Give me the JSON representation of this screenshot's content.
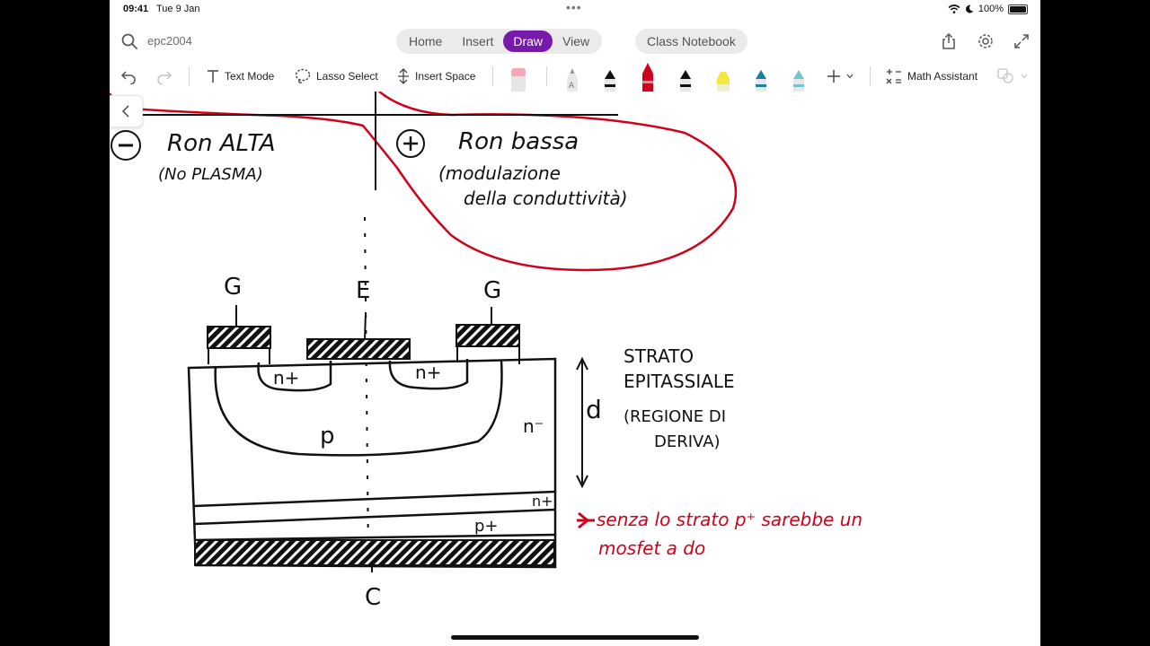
{
  "status_bar": {
    "time": "09:41",
    "date": "Tue 9 Jan",
    "battery": "100%",
    "battery_level": 1.0
  },
  "header": {
    "notebook_name": "epc2004",
    "tabs": [
      {
        "label": "Home",
        "active": false
      },
      {
        "label": "Insert",
        "active": false
      },
      {
        "label": "Draw",
        "active": true
      },
      {
        "label": "View",
        "active": false
      }
    ],
    "class_notebook_label": "Class Notebook",
    "accent_color": "#7719aa"
  },
  "toolbar": {
    "text_mode_label": "Text Mode",
    "lasso_select_label": "Lasso Select",
    "insert_space_label": "Insert Space",
    "math_assistant_label": "Math Assistant",
    "pens": [
      {
        "name": "eraser",
        "color": "#f2a9b8"
      },
      {
        "name": "pencil",
        "color": "#9a9a9a"
      },
      {
        "name": "black-pen",
        "color": "#111111"
      },
      {
        "name": "red-pen",
        "color": "#d0021b"
      },
      {
        "name": "black-pen-2",
        "color": "#111111"
      },
      {
        "name": "highlighter",
        "color": "#f5e642"
      },
      {
        "name": "teal-pen",
        "color": "#1d7fa0"
      },
      {
        "name": "light-teal-pen",
        "color": "#74c3d2"
      }
    ]
  },
  "notes": {
    "minus_label": "Ron ALTA",
    "minus_sub": "(No PLASMA)",
    "plus_label": "Ron bassa",
    "plus_sub_1": "(modulazione",
    "plus_sub_2": "della conduttività)",
    "gate_left": "G",
    "emitter": "E",
    "gate_right": "G",
    "n_plus_left": "n+",
    "n_plus_right": "n+",
    "p_region": "p",
    "n_minus": "n⁻",
    "n_plus_buffer": "n+",
    "p_plus": "p+",
    "collector": "C",
    "thickness": "d",
    "epi_1": "STRATO",
    "epi_2": "EPITASSIALE",
    "epi_3": "(REGIONE DI",
    "epi_4": "DERIVA)",
    "red_note_1": "senza lo strato p⁺ sarebbe un",
    "red_note_2": "mosfet a do",
    "ink_color": "#111111",
    "red_ink_color": "#d0021b"
  }
}
